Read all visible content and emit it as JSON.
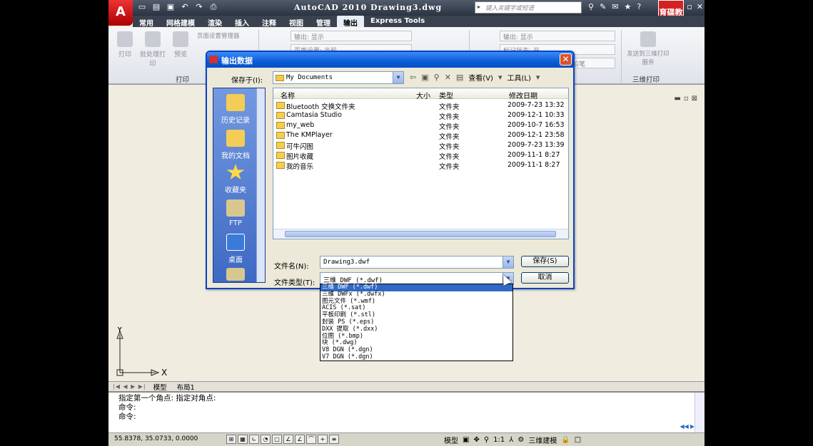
{
  "app": {
    "logo": "A",
    "title": "AutoCAD 2010  Drawing3.dwg",
    "search_placeholder": "键入关键字或短语",
    "brand": "育碟教育",
    "tabs": [
      "常用",
      "网格建模",
      "渲染",
      "插入",
      "注释",
      "视图",
      "管理",
      "输出",
      "Express Tools"
    ],
    "active_tab": "输出"
  },
  "ribbon": {
    "plot_buttons": [
      "打印",
      "批处理打印",
      "预览"
    ],
    "page_setup": "页面设置管理器",
    "output_label": "输出: 显示",
    "page_setup2": "页面设置: 当前",
    "output_label2": "输出: 显示",
    "preview_label": "标记状态: 开",
    "send_3d": "发送到三维打印服务",
    "panel_plot": "打印",
    "panel_3dprint": "三维打印",
    "pen": "铅笔"
  },
  "dialog": {
    "title": "输出数据",
    "save_in_label": "保存于(I):",
    "save_in_value": "My Documents",
    "views_label": "查看(V)",
    "tools_label": "工具(L)",
    "columns": {
      "name": "名称",
      "size": "大小",
      "type": "类型",
      "date": "修改日期"
    },
    "files": [
      {
        "name": "Bluetooth 交换文件夹",
        "type": "文件夹",
        "date": "2009-7-23 13:32"
      },
      {
        "name": "Camtasia Studio",
        "type": "文件夹",
        "date": "2009-12-1 10:33"
      },
      {
        "name": "my_web",
        "type": "文件夹",
        "date": "2009-10-7 16:53"
      },
      {
        "name": "The KMPlayer",
        "type": "文件夹",
        "date": "2009-12-1 23:58"
      },
      {
        "name": "可牛闪图",
        "type": "文件夹",
        "date": "2009-7-23 13:39"
      },
      {
        "name": "图片收藏",
        "type": "文件夹",
        "date": "2009-11-1 8:27"
      },
      {
        "name": "我的音乐",
        "type": "文件夹",
        "date": "2009-11-1 8:27"
      }
    ],
    "places": [
      "历史记录",
      "我的文档",
      "收藏夹",
      "FTP",
      "桌面"
    ],
    "filename_label": "文件名(N):",
    "filename_value": "Drawing3.dwf",
    "filetype_label": "文件类型(T):",
    "filetype_value": "三维 DWF (*.dwf)",
    "save_button": "保存(S)",
    "cancel_button": "取消",
    "filetype_options": [
      "三维 DWF (*.dwf)",
      "三维 DWFx (*.dwfx)",
      "图元文件 (*.wmf)",
      "ACIS (*.sat)",
      "平板印刷 (*.stl)",
      "封装 PS (*.eps)",
      "DXX 提取 (*.dxx)",
      "位图 (*.bmp)",
      "块 (*.dwg)",
      "V8 DGN (*.dgn)",
      "V7 DGN (*.dgn)"
    ]
  },
  "drawing": {
    "ucs_y": "Y",
    "ucs_x": "X",
    "layout_tabs": [
      "模型",
      "布局1"
    ]
  },
  "command": {
    "lines": [
      "指定第一个角点: 指定对角点:",
      "命令:",
      "命令:"
    ]
  },
  "status": {
    "coords": "55.8378, 35.0733, 0.0000",
    "model": "模型",
    "scale": "1:1",
    "workspace": "三维建模"
  }
}
